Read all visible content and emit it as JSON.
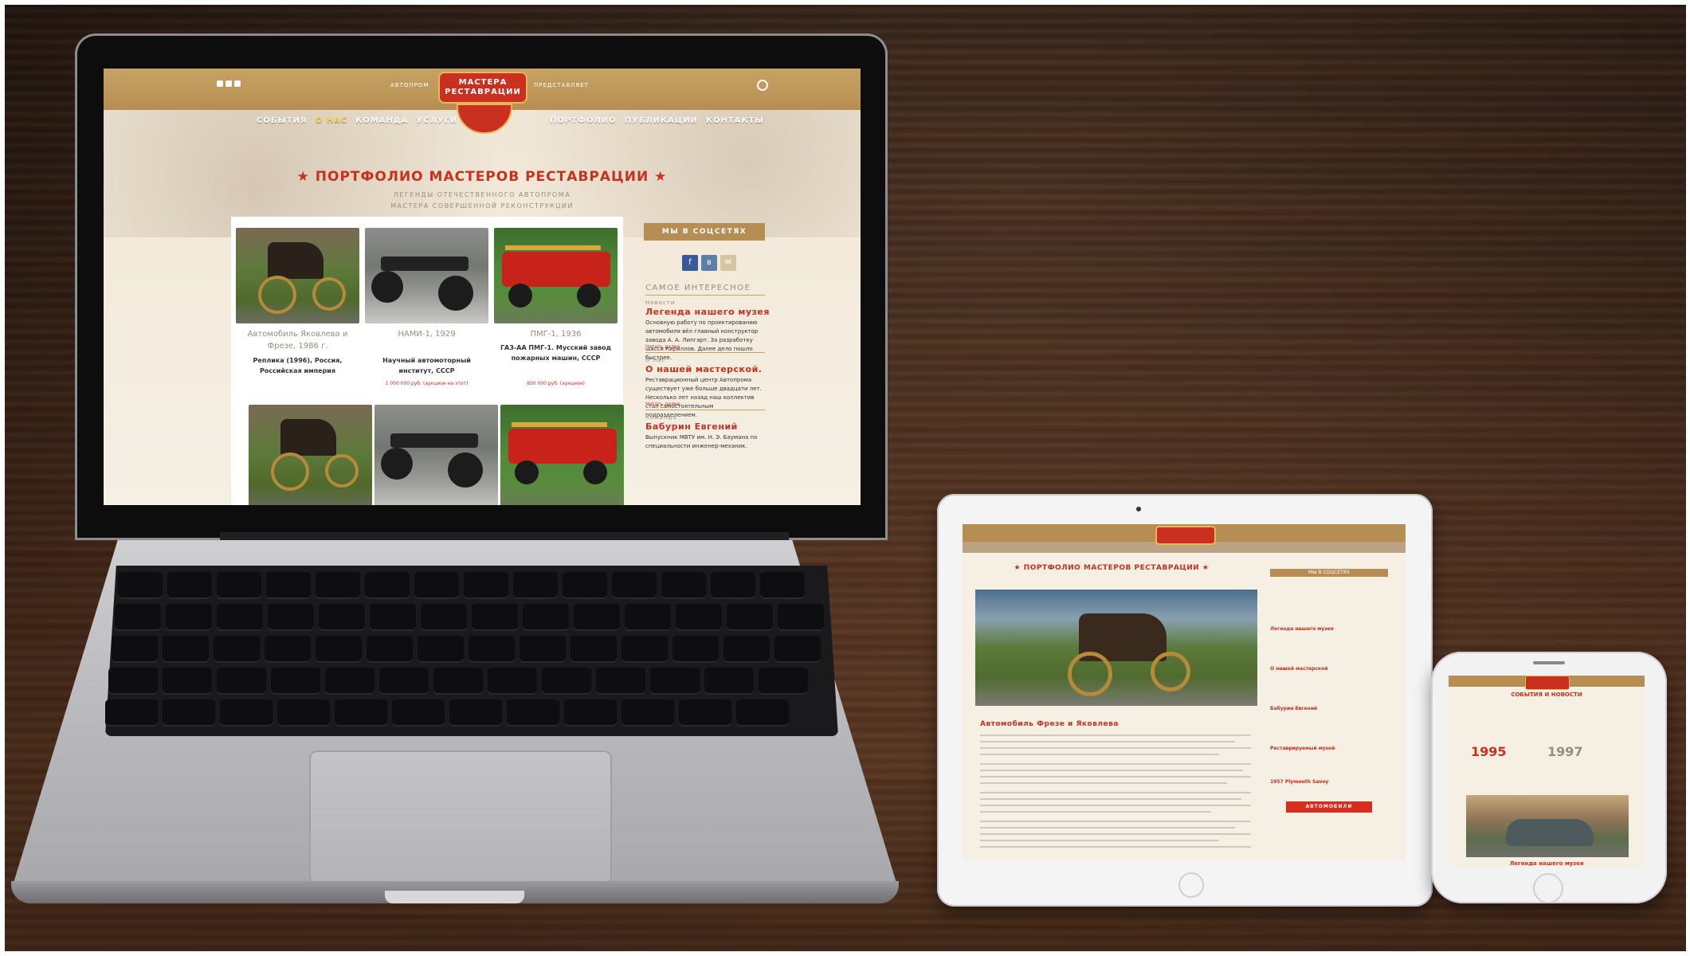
{
  "laptop": {
    "header": {
      "left_label": "АВТОПРОМ",
      "right_label": "ПРЕДСТАВЛЯЕТ",
      "logo_text": "МАСТЕРА РЕСТАВРАЦИИ",
      "nav_left": [
        "СОБЫТИЯ",
        "О НАС",
        "КОМАНДА",
        "УСЛУГИ"
      ],
      "nav_right": [
        "ПОРТФОЛИО",
        "ПУБЛИКАЦИИ",
        "КОНТАКТЫ"
      ],
      "active_nav": "О НАС"
    },
    "hero": {
      "title": "★ ПОРТФОЛИО МАСТЕРОВ РЕСТАВРАЦИИ ★",
      "subtitle_1": "ЛЕГЕНДЫ ОТЕЧЕСТВЕННОГО АВТОПРОМА",
      "subtitle_2": "МАСТЕРА СОВЕРШЕННОЙ РЕКОНСТРУКЦИИ"
    },
    "cards": [
      {
        "title": "Автомобиль Яковлева и Фрезе, 1986 г.",
        "desc": "Реплика (1996), Россия, Российская империя",
        "price": ""
      },
      {
        "title": "НАМИ-1, 1929",
        "desc": "Научный автомоторный институт, СССР",
        "price": "1 000 000 руб. (аукцион на этот)"
      },
      {
        "title": "ПМГ-1, 1936",
        "desc": "ГАЗ-АА ПМГ-1. Мусский завод пожарных машин, СССР",
        "price": "800 000 руб. (аукцион)"
      }
    ],
    "sidebar": {
      "social_button": "МЫ В СОЦСЕТЯХ",
      "section_title": "САМОЕ ИНТЕРЕСНОЕ",
      "items": [
        {
          "category": "Новости",
          "title": "Легенда нашего музея",
          "text": "Основную работу по проектированию автомобиля вёл главный конструктор завода А. А. Липгарт. За разработку шасси Кириллов. Далее дело пошло быстрее.",
          "more": "Читать далее"
        },
        {
          "category": "О нас",
          "title": "О нашей мастерской.",
          "text": "Реставрационный центр Автопрома существует уже больше двадцати лет. Несколько лет назад наш коллектив стал самостоятельным подразделением.",
          "more": "Читать далее"
        },
        {
          "category": "Команда",
          "title": "Бабурин Евгений",
          "text": "Выпускник МВТУ им. Н. Э. Баумана по специальности инженер-механик.",
          "more": ""
        }
      ]
    }
  },
  "tablet": {
    "title": "★ ПОРТФОЛИО МАСТЕРОВ РЕСТАВРАЦИИ ★",
    "social_button": "МЫ В СОЦСЕТЯХ",
    "article_title": "Автомобиль Фрезе и Яковлева",
    "side_links": [
      "Легенда нашего музея",
      "О нашей мастерской",
      "Бабурин Евгений",
      "Реставрируемый музей",
      "1957 Plymouth Savoy"
    ],
    "red_button": "АВТОМОБИЛИ"
  },
  "phone": {
    "title": "СОБЫТИЯ И НОВОСТИ",
    "years": [
      "1995",
      "1997"
    ],
    "bottom_link": "Легенда нашего музея"
  },
  "colors": {
    "accent_red": "#c9301f",
    "gold": "#b68e53",
    "cream": "#f3eadb"
  }
}
